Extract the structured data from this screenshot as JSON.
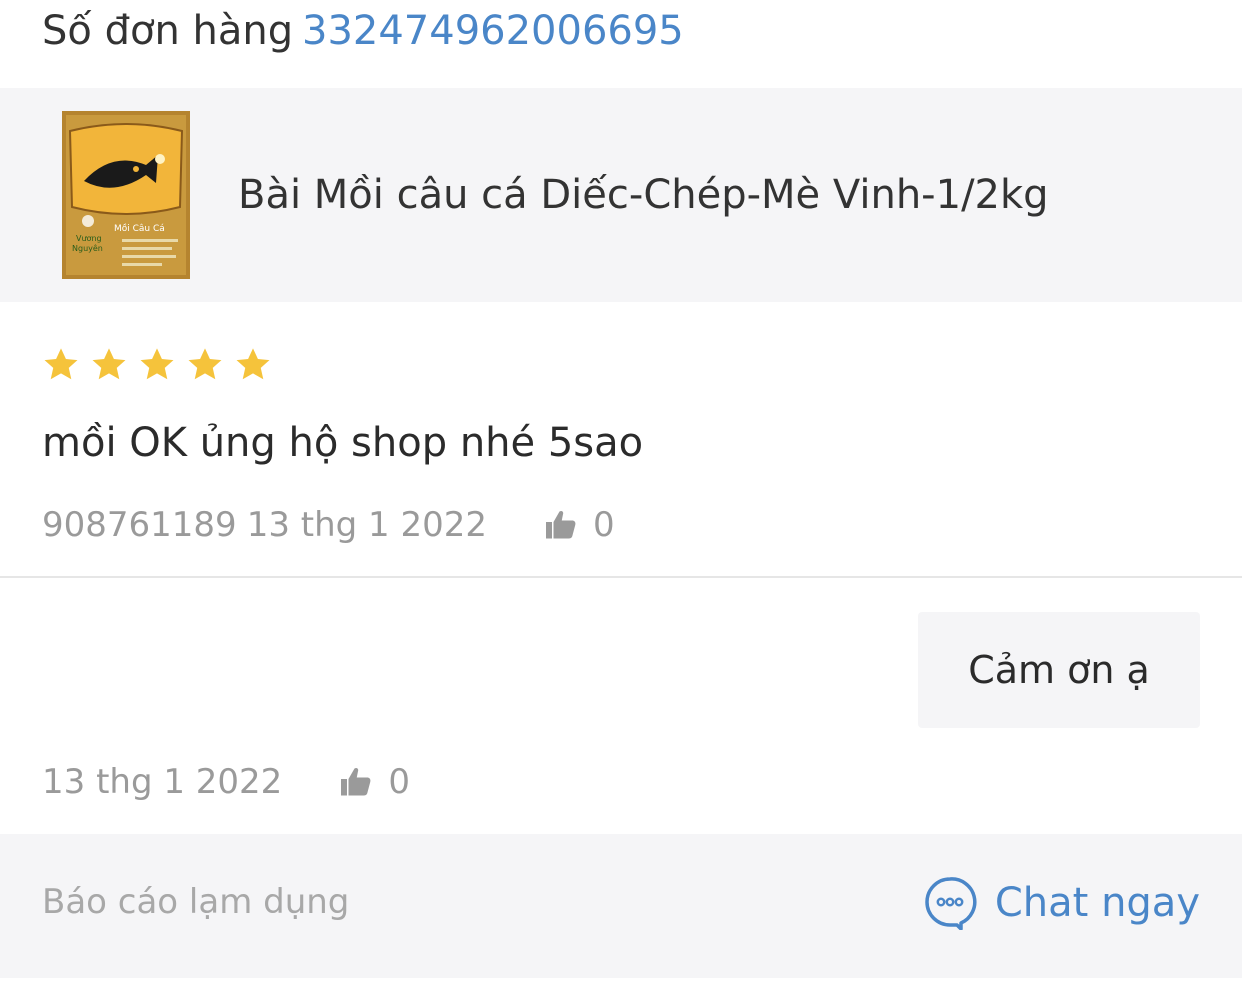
{
  "order": {
    "label": "Số đơn hàng",
    "number": "332474962006695"
  },
  "product": {
    "name": "Bài Mồi câu cá Diếc-Chép-Mè Vinh-1/2kg",
    "thumbnail_icon": "fish-bait-package-image",
    "thumbnail_text_1": "Mồi Câu Cá",
    "thumbnail_text_2": "Vương",
    "thumbnail_text_3": "Nguyên"
  },
  "review": {
    "rating": 5,
    "rating_max": 5,
    "star_color": "#f5c33b",
    "text": "mồi OK ủng hộ shop nhé 5sao",
    "user": "908761189",
    "date": "13 thg 1 2022",
    "likes": "0"
  },
  "reply": {
    "text": "Cảm ơn ạ",
    "date": "13 thg 1 2022",
    "likes": "0"
  },
  "footer": {
    "report_label": "Báo cáo lạm dụng",
    "chat_label": "Chat ngay",
    "accent_color": "#4a86c8"
  }
}
